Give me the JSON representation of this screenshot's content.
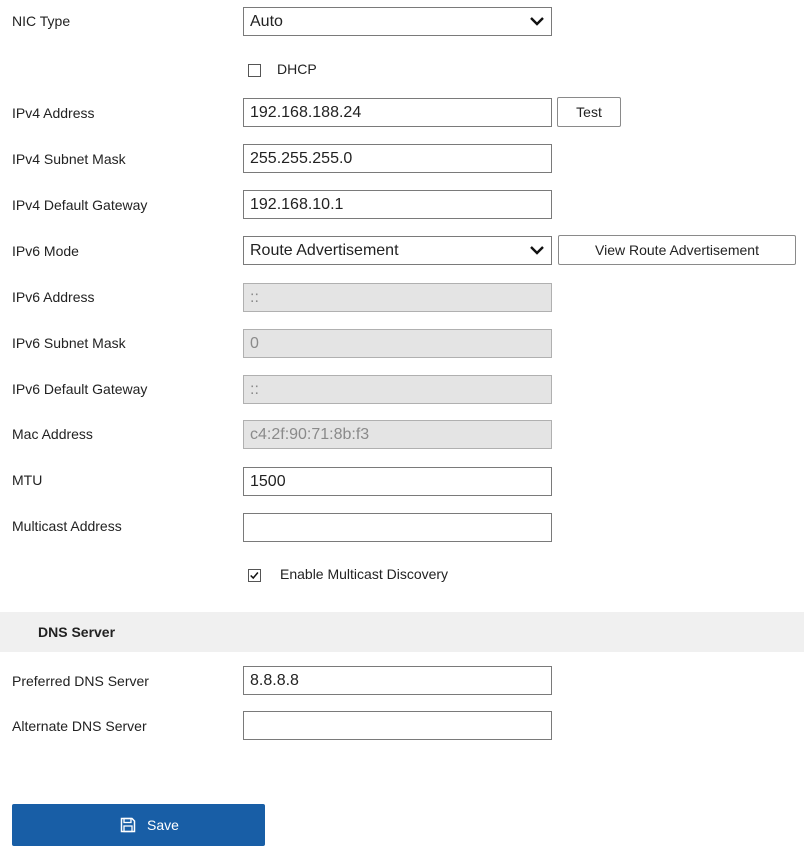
{
  "network": {
    "nic_type": {
      "label": "NIC Type",
      "value": "Auto"
    },
    "dhcp": {
      "label": "DHCP",
      "checked": false
    },
    "ipv4_address": {
      "label": "IPv4 Address",
      "value": "192.168.188.24",
      "test_label": "Test"
    },
    "ipv4_subnet_mask": {
      "label": "IPv4 Subnet Mask",
      "value": "255.255.255.0"
    },
    "ipv4_default_gateway": {
      "label": "IPv4 Default Gateway",
      "value": "192.168.10.1"
    },
    "ipv6_mode": {
      "label": "IPv6 Mode",
      "value": "Route Advertisement",
      "view_label": "View Route Advertisement"
    },
    "ipv6_address": {
      "label": "IPv6 Address",
      "value": "::"
    },
    "ipv6_subnet_mask": {
      "label": "IPv6 Subnet Mask",
      "value": "0"
    },
    "ipv6_default_gateway": {
      "label": "IPv6 Default Gateway",
      "value": "::"
    },
    "mac_address": {
      "label": "Mac Address",
      "value": "c4:2f:90:71:8b:f3"
    },
    "mtu": {
      "label": "MTU",
      "value": "1500"
    },
    "multicast_address": {
      "label": "Multicast Address",
      "value": ""
    },
    "multicast_discovery": {
      "label": "Enable Multicast Discovery",
      "checked": true
    }
  },
  "dns": {
    "section_title": "DNS Server",
    "preferred": {
      "label": "Preferred DNS Server",
      "value": "8.8.8.8"
    },
    "alternate": {
      "label": "Alternate DNS Server",
      "value": ""
    }
  },
  "actions": {
    "save_label": "Save",
    "save_icon": "save-icon"
  },
  "colors": {
    "primary": "#185ea6",
    "section_bg": "#f0f0f0",
    "disabled_bg": "#e4e4e4"
  }
}
